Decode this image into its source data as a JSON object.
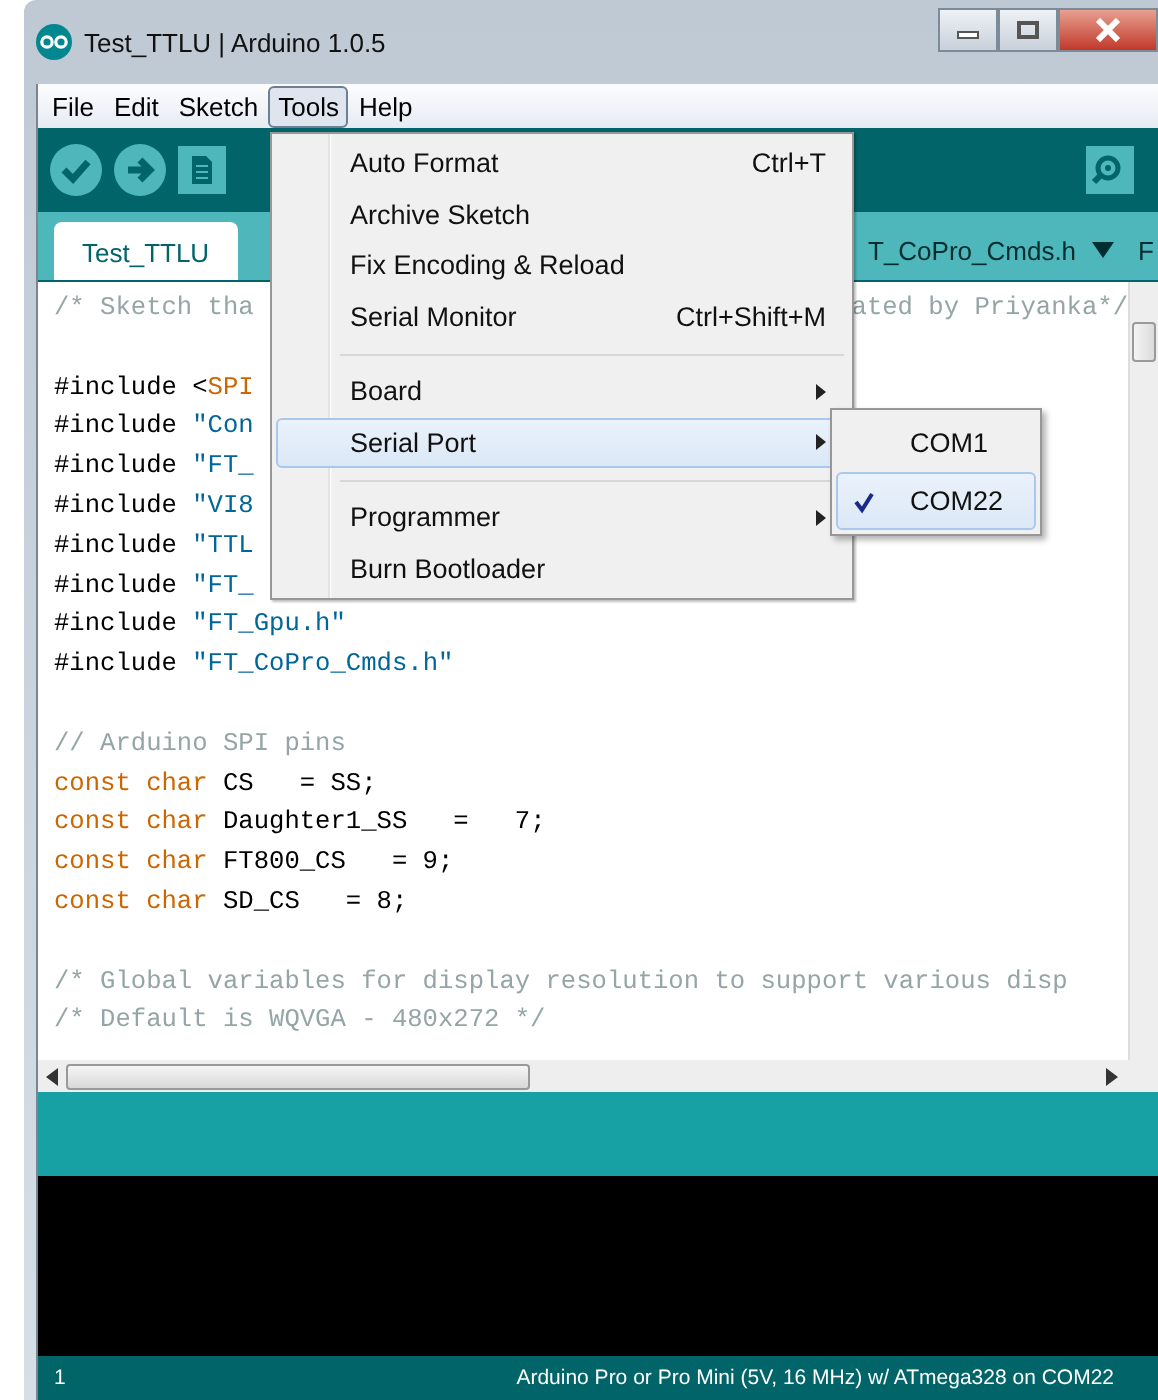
{
  "window": {
    "title": "Test_TTLU | Arduino 1.0.5"
  },
  "menu_bar": [
    {
      "label": "File",
      "selected": false
    },
    {
      "label": "Edit",
      "selected": false
    },
    {
      "label": "Sketch",
      "selected": false
    },
    {
      "label": "Tools",
      "selected": true
    },
    {
      "label": "Help",
      "selected": false
    }
  ],
  "tabs": [
    {
      "label": "Test_TTLU",
      "selected": true
    },
    {
      "label": "T_CoPro_Cmds.h",
      "selected": false
    },
    {
      "label": "F",
      "selected": false
    }
  ],
  "editor": {
    "lines": [
      {
        "kind": "code",
        "left": [
          {
            "kind": "comment",
            "text": "/* Sketch tha"
          }
        ],
        "right": [
          {
            "kind": "comment",
            "text": "ated by Priyanka*/"
          }
        ]
      },
      {
        "kind": "blank"
      },
      {
        "kind": "code",
        "left": [
          {
            "kind": "plain",
            "text": "#include <"
          },
          {
            "kind": "keyword",
            "text": "SPI"
          }
        ]
      },
      {
        "kind": "code",
        "left": [
          {
            "kind": "plain",
            "text": "#include "
          },
          {
            "kind": "string",
            "text": "\"Con"
          }
        ]
      },
      {
        "kind": "code",
        "left": [
          {
            "kind": "plain",
            "text": "#include "
          },
          {
            "kind": "string",
            "text": "\"FT_"
          }
        ]
      },
      {
        "kind": "code",
        "left": [
          {
            "kind": "plain",
            "text": "#include "
          },
          {
            "kind": "string",
            "text": "\"VI8"
          }
        ]
      },
      {
        "kind": "code",
        "left": [
          {
            "kind": "plain",
            "text": "#include "
          },
          {
            "kind": "string",
            "text": "\"TTL"
          }
        ]
      },
      {
        "kind": "code",
        "left": [
          {
            "kind": "plain",
            "text": "#include "
          },
          {
            "kind": "string",
            "text": "\"FT_"
          }
        ]
      },
      {
        "kind": "code",
        "left": [
          {
            "kind": "plain",
            "text": "#include "
          },
          {
            "kind": "string",
            "text": "\"FT_Gpu.h\""
          }
        ]
      },
      {
        "kind": "code",
        "left": [
          {
            "kind": "plain",
            "text": "#include "
          },
          {
            "kind": "string",
            "text": "\"FT_CoPro_Cmds.h\""
          }
        ]
      },
      {
        "kind": "blank"
      },
      {
        "kind": "code",
        "left": [
          {
            "kind": "comment",
            "text": "// Arduino SPI pins"
          }
        ]
      },
      {
        "kind": "code",
        "left": [
          {
            "kind": "keyword",
            "text": "const char"
          },
          {
            "kind": "plain",
            "text": " CS   = SS;"
          }
        ]
      },
      {
        "kind": "code",
        "left": [
          {
            "kind": "keyword",
            "text": "const char"
          },
          {
            "kind": "plain",
            "text": " Daughter1_SS   =   7;"
          }
        ]
      },
      {
        "kind": "code",
        "left": [
          {
            "kind": "keyword",
            "text": "const char"
          },
          {
            "kind": "plain",
            "text": " FT800_CS   = 9;"
          }
        ]
      },
      {
        "kind": "code",
        "left": [
          {
            "kind": "keyword",
            "text": "const char"
          },
          {
            "kind": "plain",
            "text": " SD_CS   = 8;"
          }
        ]
      },
      {
        "kind": "blank"
      },
      {
        "kind": "code",
        "left": [
          {
            "kind": "comment",
            "text": "/* Global variables for display resolution to support various disp"
          }
        ]
      },
      {
        "kind": "code",
        "left": [
          {
            "kind": "comment",
            "text": "/* Default is WQVGA - 480x272 */"
          }
        ]
      }
    ]
  },
  "tools_menu": {
    "items": [
      {
        "kind": "item",
        "label": "Auto Format",
        "shortcut": "Ctrl+T",
        "selected": false
      },
      {
        "kind": "item",
        "label": "Archive Sketch",
        "selected": false
      },
      {
        "kind": "item",
        "label": "Fix Encoding & Reload",
        "selected": false
      },
      {
        "kind": "item",
        "label": "Serial Monitor",
        "shortcut": "Ctrl+Shift+M",
        "selected": false
      },
      {
        "kind": "separator"
      },
      {
        "kind": "submenu",
        "label": "Board",
        "selected": false
      },
      {
        "kind": "submenu",
        "label": "Serial Port",
        "selected": true
      },
      {
        "kind": "separator"
      },
      {
        "kind": "submenu",
        "label": "Programmer",
        "selected": false
      },
      {
        "kind": "item",
        "label": "Burn Bootloader",
        "selected": false
      }
    ]
  },
  "serial_port_submenu": [
    {
      "label": "COM1",
      "checked": false,
      "selected": false
    },
    {
      "label": "COM22",
      "checked": true,
      "selected": true
    }
  ],
  "status_bar": {
    "line": "1",
    "board": "Arduino Pro or Pro Mini (5V, 16 MHz) w/ ATmega328 on COM22"
  }
}
